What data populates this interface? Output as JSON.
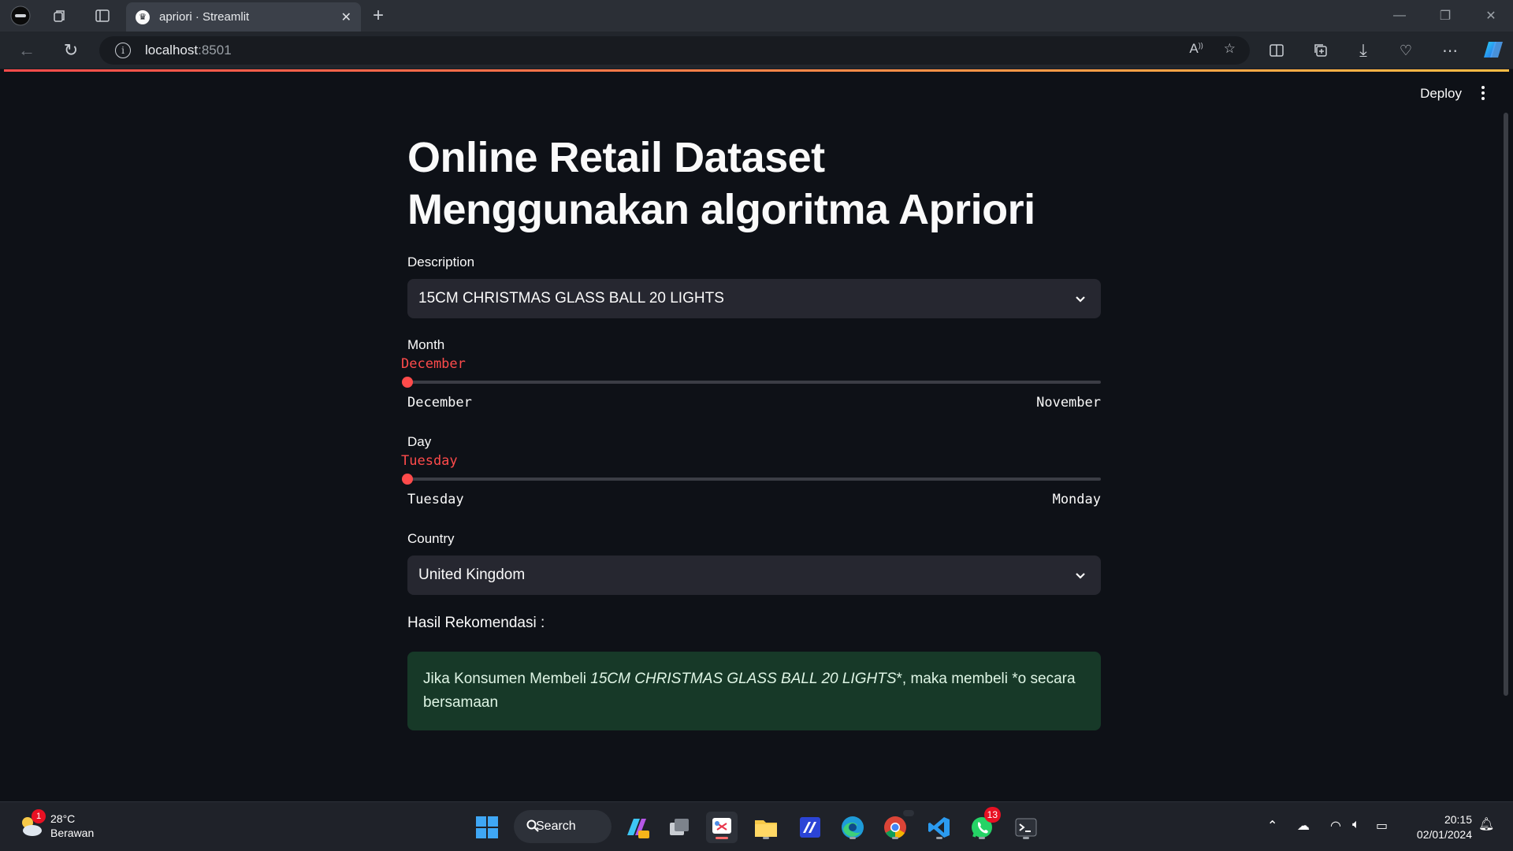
{
  "browser": {
    "tab_title": "apriori · Streamlit",
    "address_host": "localhost",
    "address_port": ":8501"
  },
  "app": {
    "deploy_label": "Deploy",
    "title": "Online Retail Dataset Menggunakan algoritma Apriori",
    "description": {
      "label": "Description",
      "selected": "15CM CHRISTMAS GLASS BALL 20 LIGHTS"
    },
    "month": {
      "label": "Month",
      "value": "December",
      "min_label": "December",
      "max_label": "November"
    },
    "day": {
      "label": "Day",
      "value": "Tuesday",
      "min_label": "Tuesday",
      "max_label": "Monday"
    },
    "country": {
      "label": "Country",
      "selected": "United Kingdom"
    },
    "result": {
      "heading": "Hasil Rekomendasi :",
      "prefix": "Jika Konsumen Membeli ",
      "item": "15CM CHRISTMAS GLASS BALL 20 LIGHTS",
      "suffix": "*, maka membeli *o secara bersamaan"
    }
  },
  "taskbar": {
    "weather_temp": "28°C",
    "weather_desc": "Berawan",
    "weather_badge": "1",
    "search_label": "Search",
    "whatsapp_badge": "13",
    "time": "20:15",
    "date": "02/01/2024"
  },
  "colors": {
    "accent": "#ff4b4b",
    "background": "#0e1117",
    "widget_bg": "#262730",
    "success_bg": "#173928"
  }
}
